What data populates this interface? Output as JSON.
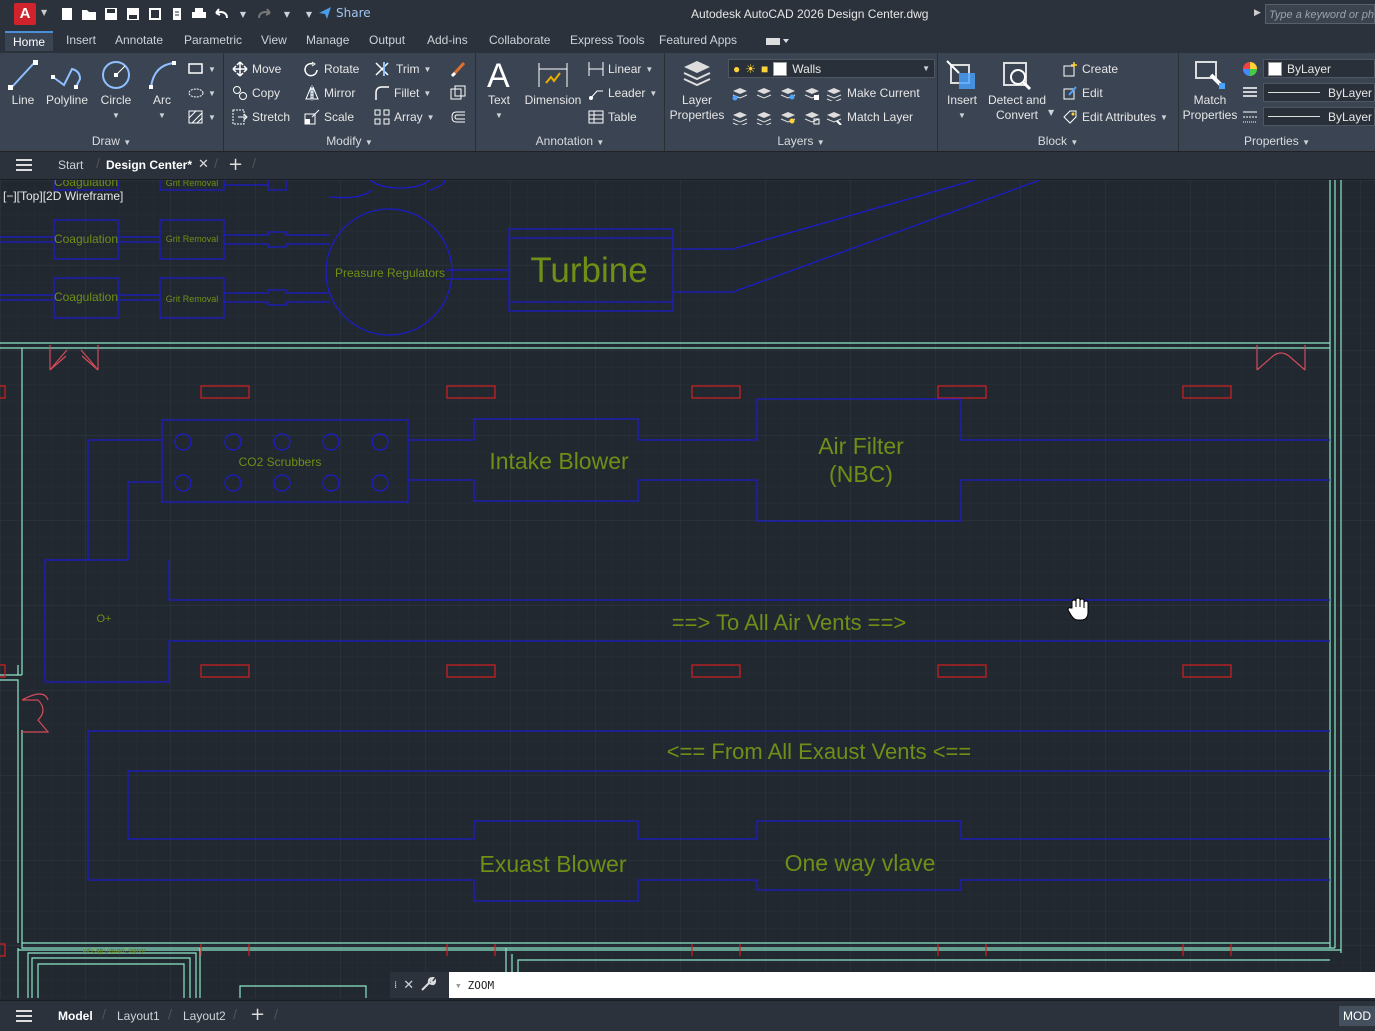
{
  "titlebar": {
    "app_letter": "A",
    "share_label": "Share",
    "title": "Autodesk AutoCAD 2026    Design Center.dwg",
    "search_placeholder": "Type a keyword or phrase"
  },
  "ribbon_tabs": [
    "Home",
    "Insert",
    "Annotate",
    "Parametric",
    "View",
    "Manage",
    "Output",
    "Add-ins",
    "Collaborate",
    "Express Tools",
    "Featured Apps"
  ],
  "draw": {
    "title": "Draw",
    "line": "Line",
    "polyline": "Polyline",
    "circle": "Circle",
    "arc": "Arc"
  },
  "modify": {
    "title": "Modify",
    "move": "Move",
    "rotate": "Rotate",
    "trim": "Trim",
    "copy": "Copy",
    "mirror": "Mirror",
    "fillet": "Fillet",
    "stretch": "Stretch",
    "scale": "Scale",
    "array": "Array"
  },
  "annotation": {
    "title": "Annotation",
    "text": "Text",
    "dimension": "Dimension",
    "linear": "Linear",
    "leader": "Leader",
    "table": "Table"
  },
  "layers": {
    "title": "Layers",
    "layer_properties_1": "Layer",
    "layer_properties_2": "Properties",
    "current_layer": "Walls",
    "make_current": "Make Current",
    "match_layer": "Match Layer"
  },
  "block": {
    "title": "Block",
    "insert": "Insert",
    "detect_1": "Detect and",
    "detect_2": "Convert",
    "create": "Create",
    "edit": "Edit",
    "edit_attributes": "Edit Attributes"
  },
  "properties": {
    "title": "Properties",
    "match_1": "Match",
    "match_2": "Properties",
    "color": "ByLayer",
    "linetype": "ByLayer",
    "lineweight": "ByLayer"
  },
  "file_tabs": {
    "start": "Start",
    "active": "Design Center*"
  },
  "viewport": {
    "label": "[−][Top][2D Wireframe]"
  },
  "drawing": {
    "turbine": "Turbine",
    "pressure_regulators": "Preasure Regulators",
    "coagulation": "Coagulation",
    "grit_removal": "Grit Removal",
    "co2_scrubbers": "CO2 Scrubbers",
    "intake_blower": "Intake Blower",
    "air_filter_1": "Air Filter",
    "air_filter_2": "(NBC)",
    "to_vents": "==> To All Air Vents  ==>",
    "from_vents": "<==   From All Exaust Vents  <==",
    "exhaust_blower": "Exuast Blower",
    "one_way_valve": "One way vlave",
    "o2": "O+",
    "small_label": "Air Gap Blower/Exterior"
  },
  "command": {
    "text": "ZOOM"
  },
  "status": {
    "model": "Model",
    "layout1": "Layout1",
    "layout2": "Layout2",
    "mode": "MOD"
  },
  "colors": {
    "accent": "#4a90d9",
    "cad_blue": "#1c1cc8",
    "cad_text": "#6f8f16",
    "cad_red": "#d42020",
    "cad_cyan": "#8ee6c8",
    "grid": "#2a323c"
  }
}
